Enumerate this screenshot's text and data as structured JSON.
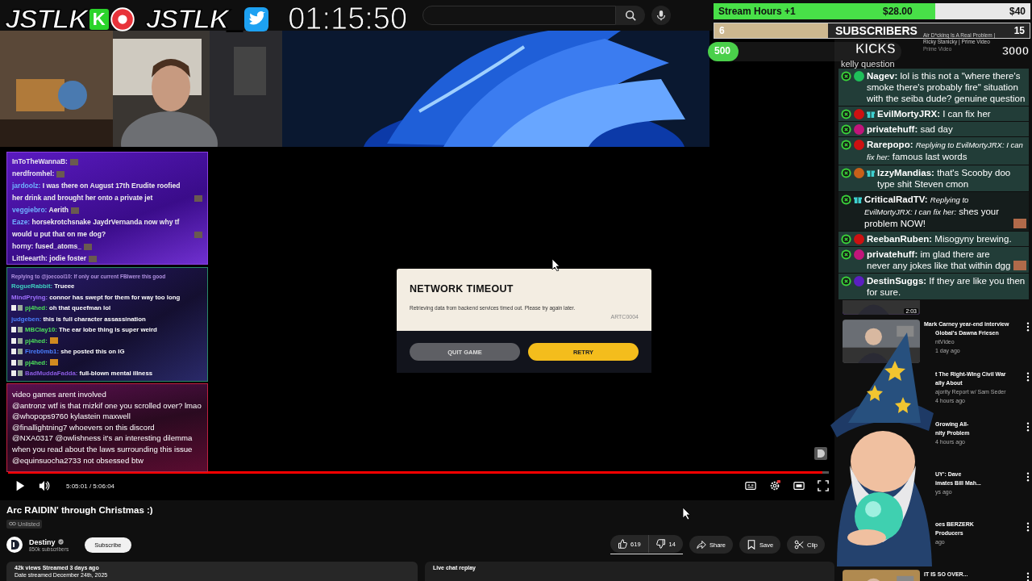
{
  "overlay": {
    "logos": [
      {
        "text": "JSTLK",
        "badge": "K",
        "kind": "record"
      },
      {
        "text": "JSTLK_",
        "kind": "bird"
      }
    ],
    "timer": "01:15:50"
  },
  "goals": {
    "donation": {
      "label": "Stream Hours +1",
      "current": "$28.00",
      "target": "$40",
      "level": 0.7
    },
    "subs": {
      "current": "6",
      "label": "SUBSCRIBERS",
      "target": "15",
      "level": 0.36
    },
    "kicks": {
      "current": "500",
      "label": "KICKS",
      "target": "3000",
      "level": 0.16
    }
  },
  "pip_video": {
    "title": "Air D*cking Is A Real Problem |",
    "subtitle": "Ricky Stanicky | Prime Video",
    "channel": "Prime Video"
  },
  "right_chat": {
    "messages": [
      {
        "text": "kelly question",
        "kind": "cut"
      },
      {
        "user": "Nagev:",
        "text": "lol is this not a \"where there's smoke there's probably fire\" situation with the seiba dude? genuine question",
        "color": "#1fbf5a",
        "gift": false
      },
      {
        "user": "EvilMortyJRX:",
        "text": "I can fix her",
        "color": "#cc1111",
        "gift": true
      },
      {
        "user": "privatehuff:",
        "text": "sad day",
        "color": "#c0157a",
        "gift": false
      },
      {
        "user": "Rarepopo:",
        "reply": "Replying to EvilMortyJRX: I can fix her:",
        "text": "famous last words",
        "color": "#cc1111",
        "gift": false
      },
      {
        "user": "IzzyMandias:",
        "text": "that's Scooby doo type shit Steven cmon",
        "color": "#c8601a",
        "gift": true
      },
      {
        "user": "CriticalRadTV:",
        "reply": "Replying to EvilMortyJRX: I can fix her:",
        "text": "shes your problem NOW!",
        "gift": true,
        "emote": true,
        "kind": "dark"
      },
      {
        "user": "ReebanRuben:",
        "text": "Misogyny brewing.",
        "color": "#cc1111",
        "gift": false
      },
      {
        "user": "privatehuff:",
        "text": "im glad there are never any jokes like that within dgg",
        "color": "#c0157a",
        "gift": false,
        "emote": true
      },
      {
        "user": "DestinSuggs:",
        "text": "If they are like you then for sure.",
        "color": "#5b1fc0",
        "gift": false
      }
    ]
  },
  "chat_a": {
    "messages": [
      {
        "user": "InToTheWannaB:",
        "color": "#e8e4f0",
        "emote": true
      },
      {
        "user": "nerdfromhel:",
        "color": "#e8e4f0",
        "emote": true
      },
      {
        "user": "jardoolz:",
        "text": "I was there on August 17th Erudite roofied her drink and brought her onto a private jet",
        "color": "#6fb0ff",
        "emote": true
      },
      {
        "user": "veggiebro:",
        "text": "Aerith",
        "color": "#6fb0ff",
        "emote": true
      },
      {
        "user": "Eaze:",
        "text": "horsekrotchsnake JaydrVernanda now why tf would u put that on me dog?",
        "color": "#6fb0ff",
        "emote": true
      },
      {
        "user": "horny:",
        "text": "fused_atoms_",
        "color": "#e8e4f0",
        "emote": true
      },
      {
        "user": "Littleearth:",
        "text": "jodie foster",
        "color": "#e8e4f0",
        "emote": true
      }
    ]
  },
  "chat_b": {
    "reply": "Replying to @joecool10: If only our current FBIwere this good",
    "messages": [
      {
        "user": "RogueRabbit:",
        "text": "Trueee",
        "color": "#3fd0c0",
        "badges": false
      },
      {
        "user": "MindPrying:",
        "text": "connor has swept for them for way too long",
        "color": "#a070ff",
        "badges": false
      },
      {
        "user": "pj4hed:",
        "text": "oh that queefman lol",
        "color": "#4ce05a",
        "badges": true
      },
      {
        "user": "judgeben:",
        "text": "this is full character assassination",
        "color": "#4a80ff",
        "badges": false
      },
      {
        "user": "MBClay10:",
        "text": "The ear lobe thing is super weird",
        "color": "#4ce05a",
        "badges": true
      },
      {
        "user": "pj4hed:",
        "color": "#4ce05a",
        "badges": true,
        "emote": true
      },
      {
        "user": "Fireb0mb1:",
        "text": "she posted this on IG",
        "color": "#4a80ff",
        "badges": true
      },
      {
        "user": "pj4hed:",
        "color": "#4ce05a",
        "badges": true,
        "emote": true
      },
      {
        "user": "BadMuddaFadda:",
        "text": "full-blown mental illness",
        "color": "#8a5ae0",
        "badges": true
      }
    ]
  },
  "chat_c": {
    "messages": [
      "video games arent involved",
      "@antronz wtf is that mizkif one you scrolled over? lmao",
      "@whopops9760 kylastein maxwell",
      "@finallightning7 whoevers on this discord",
      "@NXA0317 @owlishness it's an interesting dilemma when you read about the laws surrounding this issue",
      "@equinsuocha2733 not obsessed btw"
    ]
  },
  "dialog": {
    "title": "NETWORK TIMEOUT",
    "message": "Retrieving data from backend services timed out. Please try again later.",
    "code": "ARTC0004",
    "buttons": [
      {
        "label": "QUIT GAME",
        "kind": "secondary"
      },
      {
        "label": "RETRY",
        "kind": "primary"
      }
    ]
  },
  "player": {
    "time": "5:05:01 / 5:06:04",
    "level": 0.992
  },
  "video": {
    "title": "Arc RAIDIN' through Christmas :)",
    "badge": "Unlisted",
    "channel": "Destiny",
    "subscribers": "850k subscribers",
    "subscribe": "Subscribe",
    "likes": "619",
    "dislikes": "14",
    "actions": [
      {
        "label": "Share",
        "kind": "share"
      },
      {
        "label": "Save",
        "kind": "save"
      },
      {
        "label": "Clip",
        "kind": "clip"
      }
    ],
    "stats": "42k views  Streamed 3 days ago",
    "date": "Date streamed December 24th, 2025",
    "chat_replay": "Live chat replay"
  },
  "recommendations": [
    {
      "duration": "2:03",
      "kind": "top",
      "thumbnail": true
    },
    {
      "thumbnail": true,
      "lines": [
        {
          "text": "Mark Carney year-end interview",
          "kind": "title"
        },
        {
          "text": "Global's Dawna Friesen",
          "kind": "cut-title"
        },
        {
          "text": "ntVideo",
          "kind": "cut-meta"
        },
        {
          "text": "1 day ago",
          "kind": "cut-meta"
        }
      ]
    },
    {
      "lines": [
        {
          "text": "t The Right-Wing Civil War",
          "kind": "cut-title"
        },
        {
          "text": "ally About",
          "kind": "cut-title"
        },
        {
          "text": "ajority Report w/ Sam Seder",
          "kind": "cut-meta"
        },
        {
          "text": "4 hours ago",
          "kind": "cut-meta"
        }
      ]
    },
    {
      "lines": [
        {
          "text": "Growing All-",
          "kind": "cut-title"
        },
        {
          "text": "nity Problem",
          "kind": "cut-title"
        },
        {
          "text": "4 hours ago",
          "kind": "cut-meta"
        }
      ]
    },
    {
      "lines": [
        {
          "text": "UY': Dave",
          "kind": "cut-title"
        },
        {
          "text": "imates Bill Mah...",
          "kind": "cut-title"
        },
        {
          "text": "ys ago",
          "kind": "cut-meta"
        }
      ]
    },
    {
      "lines": [
        {
          "text": "oes BERZERK",
          "kind": "cut-title"
        },
        {
          "text": "Producers",
          "kind": "cut-title"
        },
        {
          "text": "ago",
          "kind": "cut-meta"
        }
      ]
    },
    {
      "thumbnail": true,
      "lines": [
        {
          "text": "IT IS SO OVER...",
          "kind": "title"
        }
      ]
    }
  ]
}
